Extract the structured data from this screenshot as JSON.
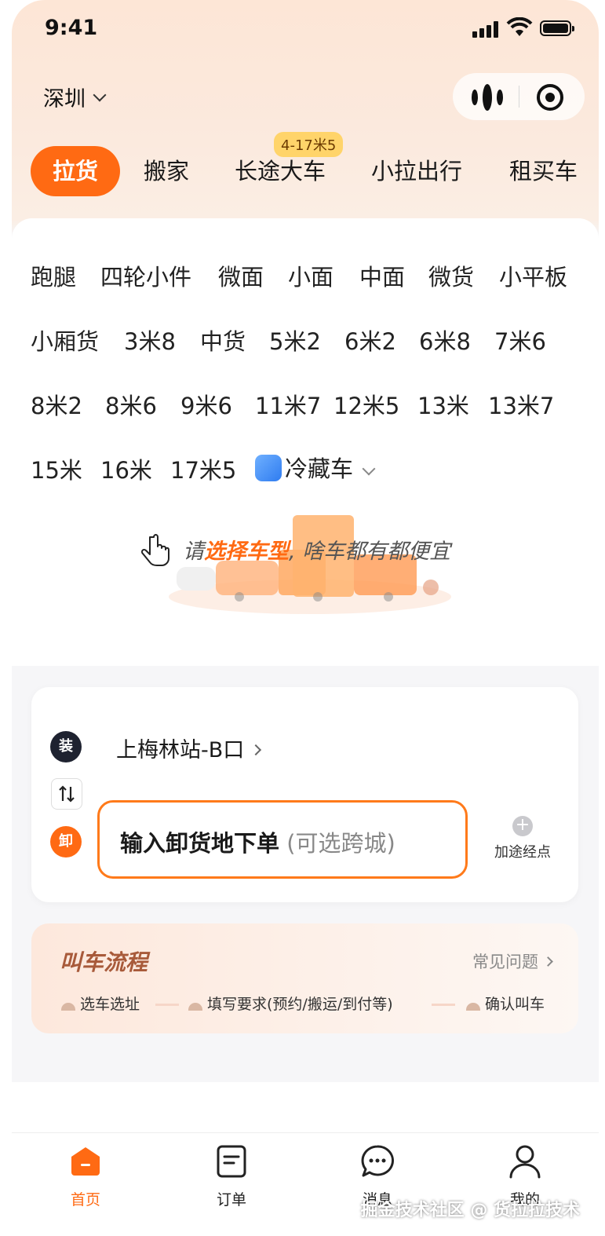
{
  "status": {
    "time": "9:41"
  },
  "header": {
    "city": "深圳"
  },
  "top_tabs": [
    {
      "label": "拉货",
      "active": true
    },
    {
      "label": "搬家"
    },
    {
      "label": "长途大车",
      "badge": "4-17米5"
    },
    {
      "label": "小拉出行"
    },
    {
      "label": "租买车"
    }
  ],
  "vehicles": {
    "row1": [
      "跑腿",
      "四轮小件",
      "微面",
      "小面",
      "中面",
      "微货",
      "小平板"
    ],
    "row2": [
      "小厢货",
      "3米8",
      "中货",
      "5米2",
      "6米2",
      "6米8",
      "7米6"
    ],
    "row3": [
      "8米2",
      "8米6",
      "9米6",
      "11米7",
      "12米5",
      "13米",
      "13米7"
    ],
    "row4": [
      "15米",
      "16米",
      "17米5",
      "冷藏车"
    ]
  },
  "hint": {
    "prefix": "请",
    "highlight": "选择车型",
    "suffix": ", 啥车都有都便宜"
  },
  "address": {
    "load_pin": "装",
    "unload_pin": "卸",
    "from": "上梅林站-B口",
    "to_main": "输入卸货地下单",
    "to_sub": " (可选跨城)",
    "waypoint": "加途经点"
  },
  "flow": {
    "title": "叫车流程",
    "faq": "常见问题",
    "steps": [
      "选车选址",
      "填写要求(预约/搬运/到付等)",
      "确认叫车"
    ]
  },
  "tabbar": [
    {
      "label": "首页",
      "icon": "home-icon",
      "active": true
    },
    {
      "label": "订单",
      "icon": "order-icon"
    },
    {
      "label": "消息",
      "icon": "message-icon"
    },
    {
      "label": "我的",
      "icon": "profile-icon"
    }
  ],
  "watermark": "掘金技术社区 @ 货拉拉技术",
  "colors": {
    "accent": "#ff6a13",
    "dark_pin": "#1e2230"
  }
}
